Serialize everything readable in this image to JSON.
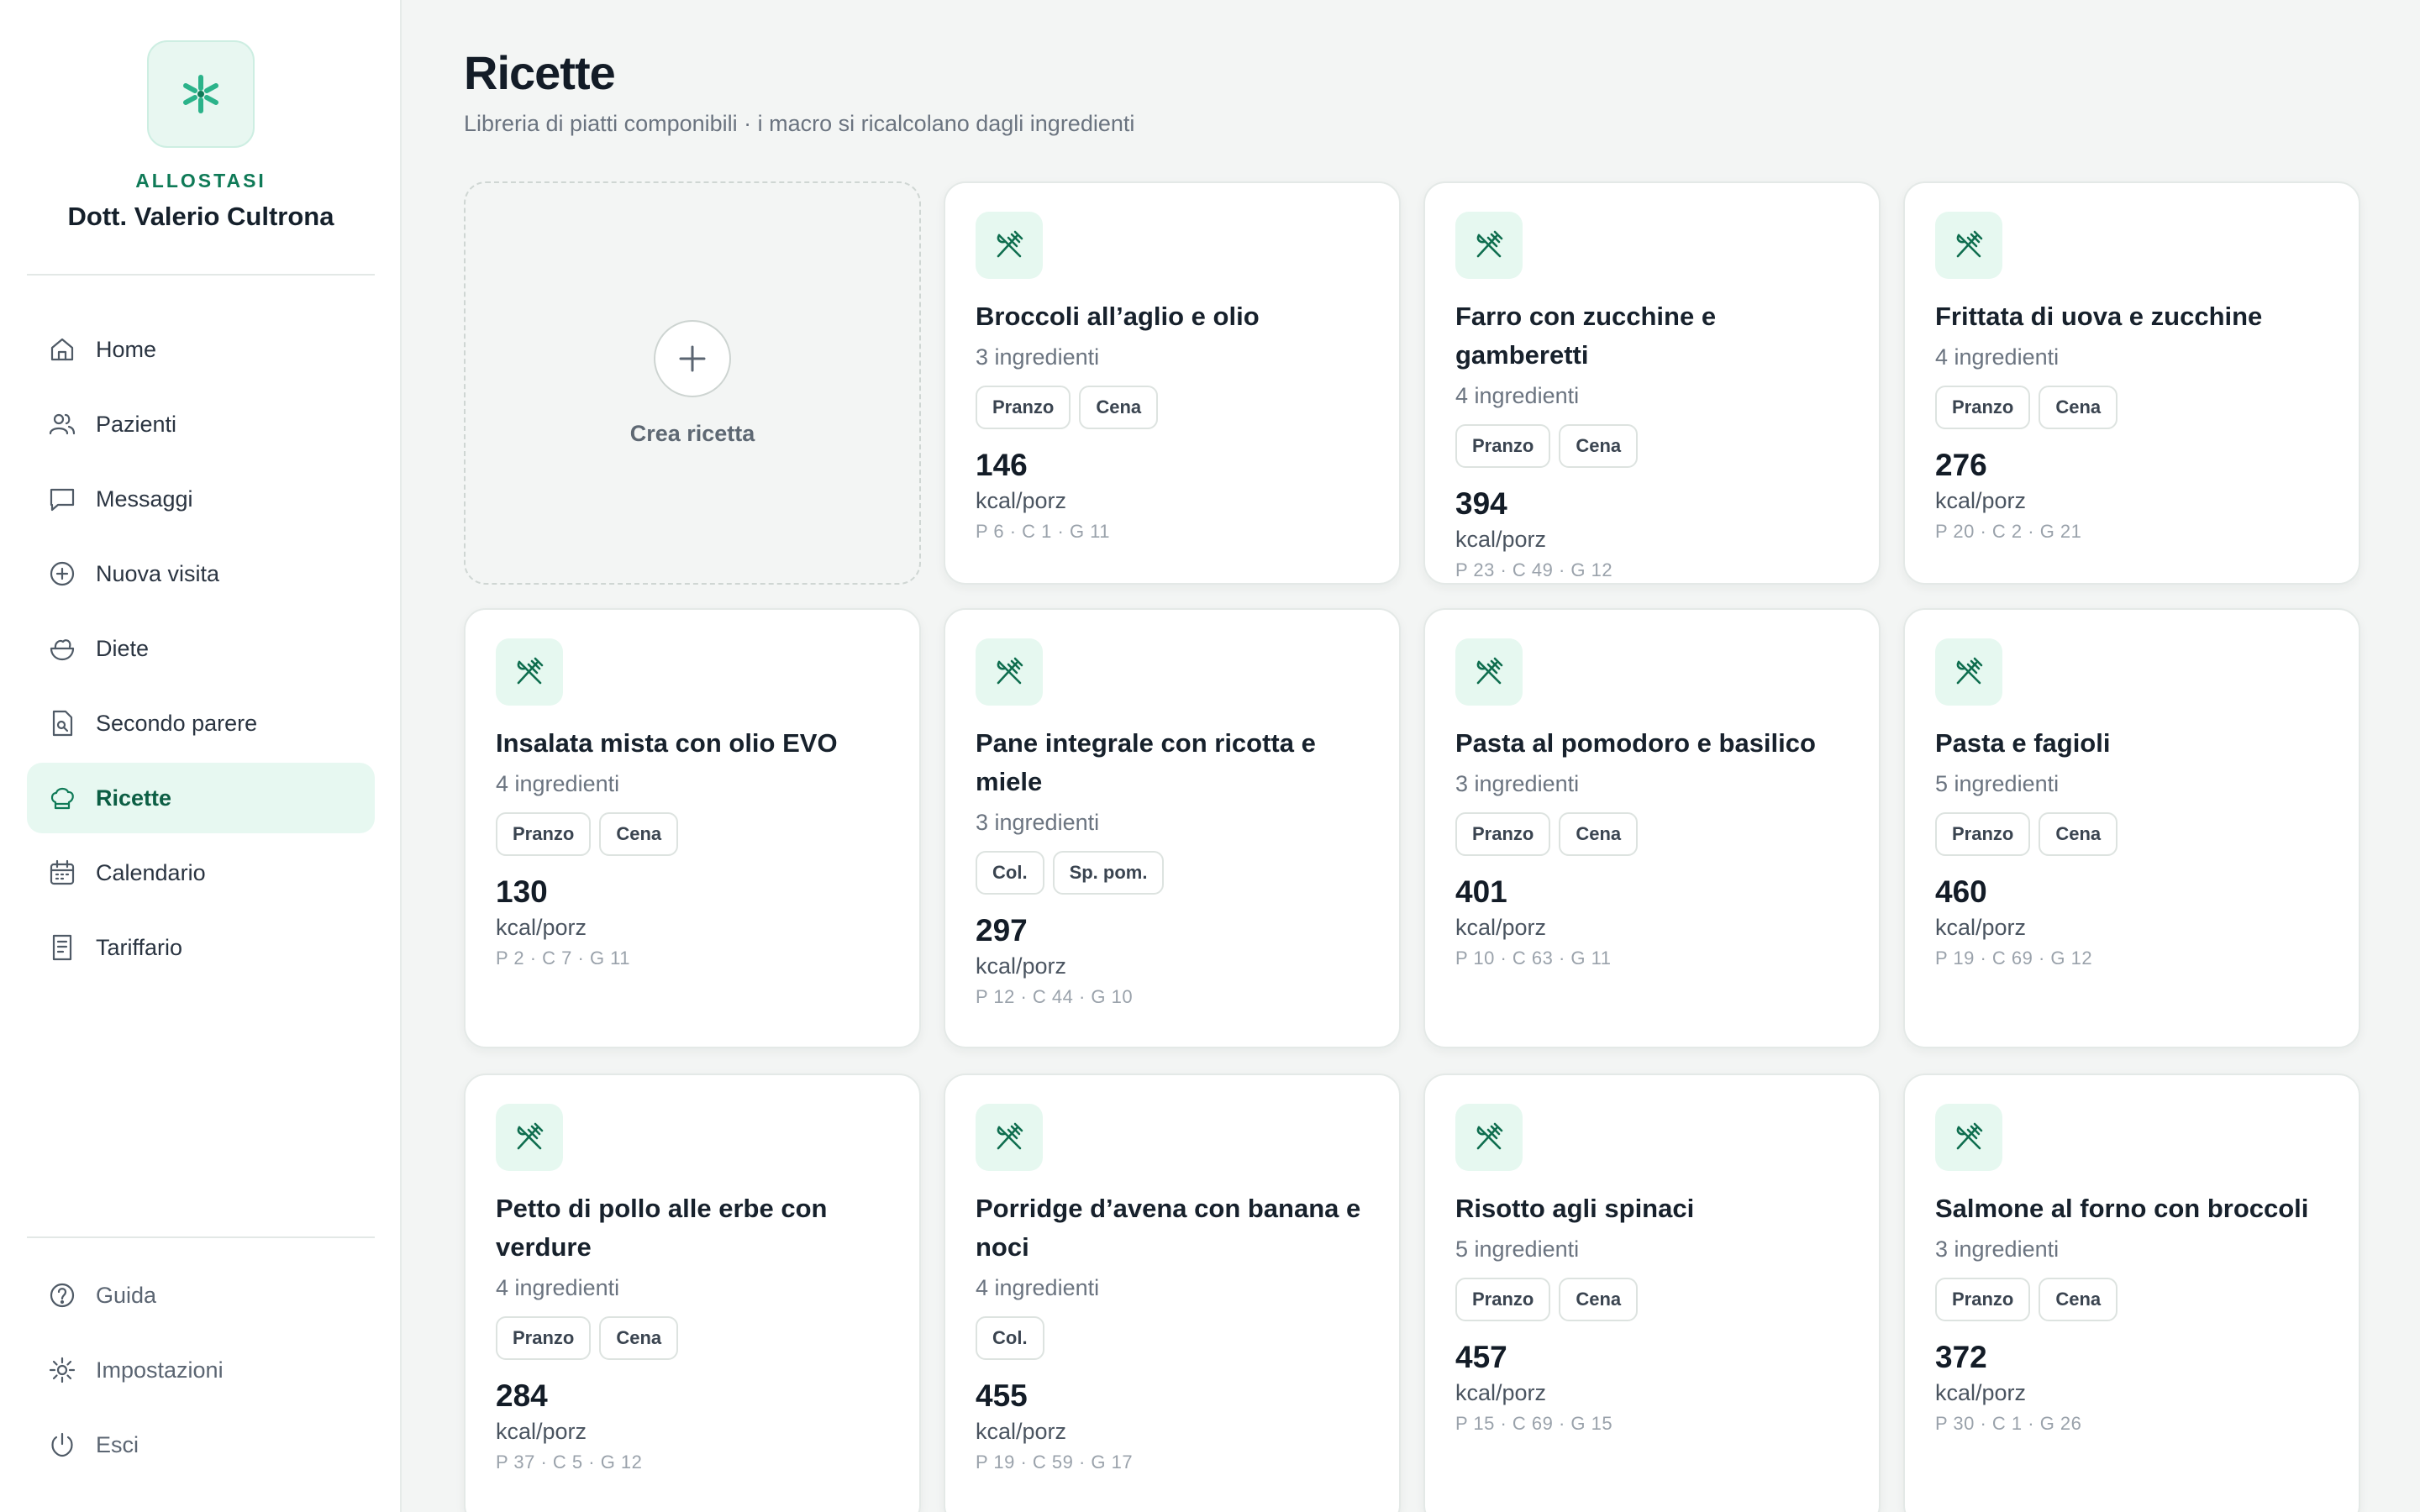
{
  "brand": {
    "name": "ALLOSTASI",
    "doctor": "Dott. Valerio Cultrona"
  },
  "nav": [
    {
      "label": "Home",
      "icon": "home-icon"
    },
    {
      "label": "Pazienti",
      "icon": "users-icon"
    },
    {
      "label": "Messaggi",
      "icon": "message-icon"
    },
    {
      "label": "Nuova visita",
      "icon": "plus-circle-icon"
    },
    {
      "label": "Diete",
      "icon": "salad-icon"
    },
    {
      "label": "Secondo parere",
      "icon": "file-search-icon"
    },
    {
      "label": "Ricette",
      "icon": "chef-hat-icon",
      "active": true
    },
    {
      "label": "Calendario",
      "icon": "calendar-icon"
    },
    {
      "label": "Tariffario",
      "icon": "receipt-icon"
    }
  ],
  "bottom_nav": [
    {
      "label": "Guida",
      "icon": "help-icon"
    },
    {
      "label": "Impostazioni",
      "icon": "gear-icon"
    },
    {
      "label": "Esci",
      "icon": "power-icon"
    }
  ],
  "page": {
    "title": "Ricette",
    "subtitle": "Libreria di piatti componibili · i macro si ricalcolano dagli ingredienti",
    "create_label": "Crea ricetta"
  },
  "recipes": [
    {
      "name": "Broccoli all’aglio e olio",
      "ingredients": "3 ingredienti",
      "tags": [
        "Pranzo",
        "Cena"
      ],
      "kcal": "146",
      "unit": "kcal/porz",
      "macros": "P 6 · C 1 · G 11"
    },
    {
      "name": "Farro con zucchine e gamberetti",
      "ingredients": "4 ingredienti",
      "tags": [
        "Pranzo",
        "Cena"
      ],
      "kcal": "394",
      "unit": "kcal/porz",
      "macros": "P 23 · C 49 · G 12"
    },
    {
      "name": "Frittata di uova e zucchine",
      "ingredients": "4 ingredienti",
      "tags": [
        "Pranzo",
        "Cena"
      ],
      "kcal": "276",
      "unit": "kcal/porz",
      "macros": "P 20 · C 2 · G 21"
    },
    {
      "name": "Insalata mista con olio EVO",
      "ingredients": "4 ingredienti",
      "tags": [
        "Pranzo",
        "Cena"
      ],
      "kcal": "130",
      "unit": "kcal/porz",
      "macros": "P 2 · C 7 · G 11"
    },
    {
      "name": "Pane integrale con ricotta e miele",
      "ingredients": "3 ingredienti",
      "tags": [
        "Col.",
        "Sp. pom."
      ],
      "kcal": "297",
      "unit": "kcal/porz",
      "macros": "P 12 · C 44 · G 10"
    },
    {
      "name": "Pasta al pomodoro e basilico",
      "ingredients": "3 ingredienti",
      "tags": [
        "Pranzo",
        "Cena"
      ],
      "kcal": "401",
      "unit": "kcal/porz",
      "macros": "P 10 · C 63 · G 11"
    },
    {
      "name": "Pasta e fagioli",
      "ingredients": "5 ingredienti",
      "tags": [
        "Pranzo",
        "Cena"
      ],
      "kcal": "460",
      "unit": "kcal/porz",
      "macros": "P 19 · C 69 · G 12"
    },
    {
      "name": "Petto di pollo alle erbe con verdure",
      "ingredients": "4 ingredienti",
      "tags": [
        "Pranzo",
        "Cena"
      ],
      "kcal": "284",
      "unit": "kcal/porz",
      "macros": "P 37 · C 5 · G 12"
    },
    {
      "name": "Porridge d’avena con banana e noci",
      "ingredients": "4 ingredienti",
      "tags": [
        "Col."
      ],
      "kcal": "455",
      "unit": "kcal/porz",
      "macros": "P 19 · C 59 · G 17"
    },
    {
      "name": "Risotto agli spinaci",
      "ingredients": "5 ingredienti",
      "tags": [
        "Pranzo",
        "Cena"
      ],
      "kcal": "457",
      "unit": "kcal/porz",
      "macros": "P 15 · C 69 · G 15"
    },
    {
      "name": "Salmone al forno con broccoli",
      "ingredients": "3 ingredienti",
      "tags": [
        "Pranzo",
        "Cena"
      ],
      "kcal": "372",
      "unit": "kcal/porz",
      "macros": "P 30 · C 1 · G 26"
    }
  ],
  "colors": {
    "accent": "#0f7a57",
    "active_bg": "#e7f8f1",
    "icon_bg": "#e6f8f0",
    "background": "#f3f5f4"
  }
}
